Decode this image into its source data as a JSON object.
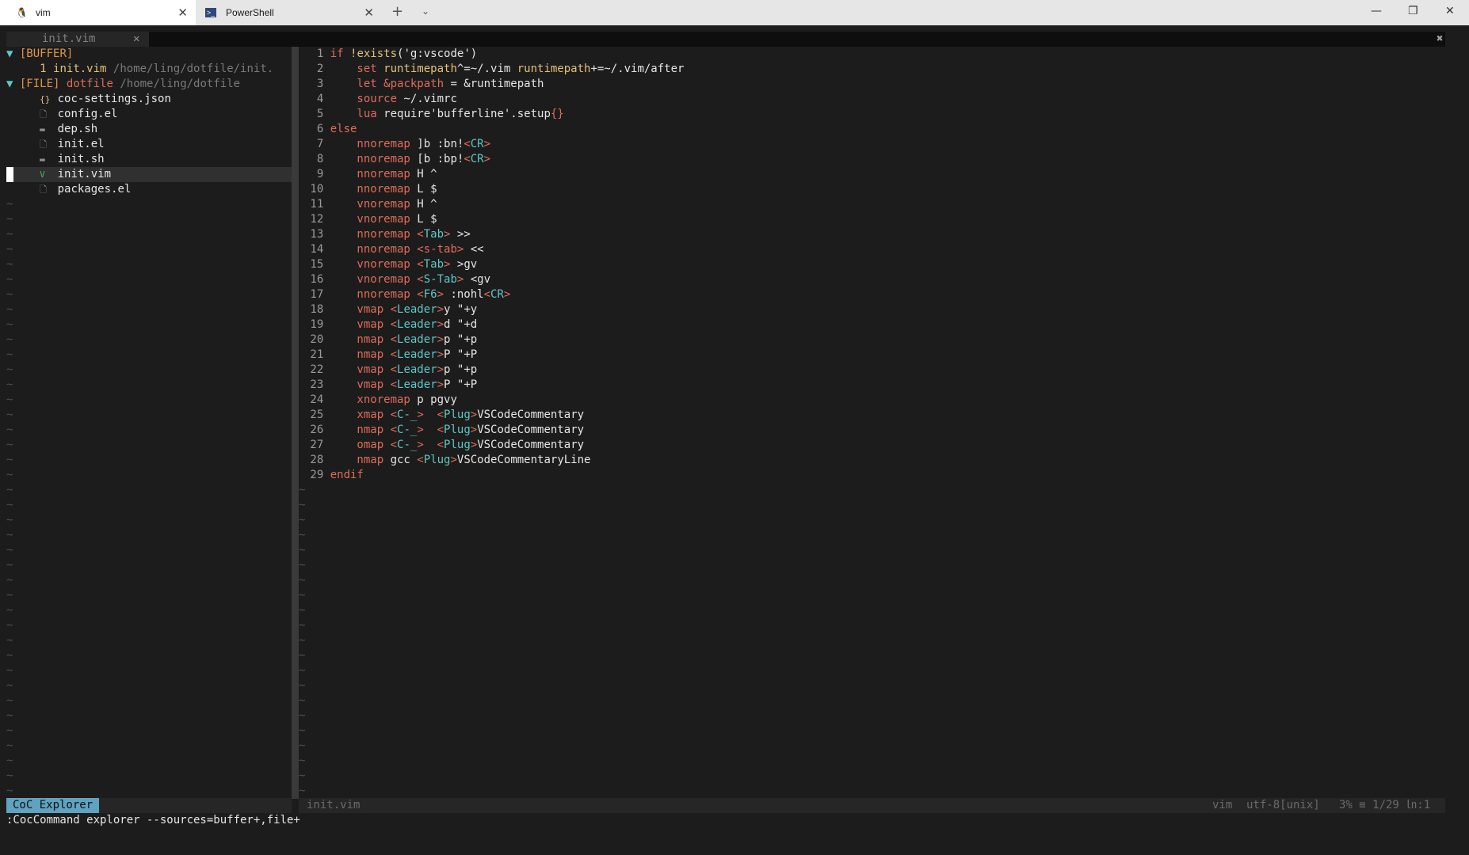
{
  "window": {
    "tabs": [
      {
        "label": "vim",
        "icon": "linux-penguin-icon",
        "active": true
      },
      {
        "label": "PowerShell",
        "icon": "powershell-icon",
        "active": false
      }
    ],
    "new_tab_glyph": "+",
    "dropdown_glyph": "⌄",
    "close_glyph": "✕",
    "controls": {
      "minimize": "—",
      "maximize": "❐",
      "close": "✕"
    }
  },
  "vim_tabline": {
    "current_tab": "init.vim",
    "close_glyph": "✕",
    "right_close": "✖"
  },
  "explorer": {
    "buffer_header": {
      "arrow": "▼",
      "label": "[BUFFER]"
    },
    "buffer_item": {
      "num": "1",
      "name": "init.vim",
      "path": "/home/ling/dotfile/init."
    },
    "file_header": {
      "arrow": "▼",
      "label": "[FILE]",
      "name": "dotfile",
      "path": "/home/ling/dotfile"
    },
    "files": [
      {
        "icon": "{}",
        "name": "coc-settings.json",
        "icon_name": "json-icon"
      },
      {
        "icon": "🗋",
        "name": "config.el",
        "icon_name": "file-icon"
      },
      {
        "icon": "▬",
        "name": "dep.sh",
        "icon_name": "shell-icon"
      },
      {
        "icon": "🗋",
        "name": "init.el",
        "icon_name": "file-icon"
      },
      {
        "icon": "▬",
        "name": "init.sh",
        "icon_name": "shell-icon"
      },
      {
        "icon": "V",
        "name": "init.vim",
        "icon_name": "vim-icon"
      },
      {
        "icon": "🗋",
        "name": "packages.el",
        "icon_name": "file-icon"
      }
    ]
  },
  "editor": {
    "line_numbers": [
      "1",
      "2",
      "3",
      "4",
      "5",
      "6",
      "7",
      "8",
      "9",
      "10",
      "11",
      "12",
      "13",
      "14",
      "15",
      "16",
      "17",
      "18",
      "19",
      "20",
      "21",
      "22",
      "23",
      "24",
      "25",
      "26",
      "27",
      "28",
      "29"
    ],
    "lines": [
      [
        [
          "if ",
          "red"
        ],
        [
          "!exists",
          "yellow"
        ],
        [
          "(",
          "white"
        ],
        [
          "'g:vscode'",
          "white"
        ],
        [
          ")",
          "white"
        ]
      ],
      [
        [
          "    set ",
          "red"
        ],
        [
          "runtimepath",
          "yellow"
        ],
        [
          "^=~/.vim ",
          "white"
        ],
        [
          "runtimepath",
          "yellow"
        ],
        [
          "+=~/.vim/after",
          "white"
        ]
      ],
      [
        [
          "    let ",
          "red"
        ],
        [
          "&packpath",
          "red"
        ],
        [
          " = &runtimepath",
          "white"
        ]
      ],
      [
        [
          "    source ",
          "red"
        ],
        [
          "~/.vimrc",
          "white"
        ]
      ],
      [
        [
          "    lua ",
          "red"
        ],
        [
          "require'bufferline'.setup",
          "white"
        ],
        [
          "{}",
          "red"
        ]
      ],
      [
        [
          "else",
          "red"
        ]
      ],
      [
        [
          "    nnoremap ",
          "red"
        ],
        [
          "]b :bn!",
          "white"
        ],
        [
          "<",
          "red"
        ],
        [
          "CR",
          "teal"
        ],
        [
          ">",
          "red"
        ]
      ],
      [
        [
          "    nnoremap ",
          "red"
        ],
        [
          "[b :bp!",
          "white"
        ],
        [
          "<",
          "red"
        ],
        [
          "CR",
          "teal"
        ],
        [
          ">",
          "red"
        ]
      ],
      [
        [
          "    nnoremap ",
          "red"
        ],
        [
          "H ^",
          "white"
        ]
      ],
      [
        [
          "    nnoremap ",
          "red"
        ],
        [
          "L $",
          "white"
        ]
      ],
      [
        [
          "    vnoremap ",
          "red"
        ],
        [
          "H ^",
          "white"
        ]
      ],
      [
        [
          "    vnoremap ",
          "red"
        ],
        [
          "L $",
          "white"
        ]
      ],
      [
        [
          "    nnoremap ",
          "red"
        ],
        [
          "<",
          "red"
        ],
        [
          "Tab",
          "teal"
        ],
        [
          "> ",
          "red"
        ],
        [
          ">>",
          "white"
        ]
      ],
      [
        [
          "    nnoremap ",
          "red"
        ],
        [
          "<s-tab>",
          "red"
        ],
        [
          " <<",
          "white"
        ]
      ],
      [
        [
          "    vnoremap ",
          "red"
        ],
        [
          "<",
          "red"
        ],
        [
          "Tab",
          "teal"
        ],
        [
          "> ",
          "red"
        ],
        [
          ">gv",
          "white"
        ]
      ],
      [
        [
          "    vnoremap ",
          "red"
        ],
        [
          "<",
          "red"
        ],
        [
          "S-Tab",
          "teal"
        ],
        [
          "> ",
          "red"
        ],
        [
          "<gv",
          "white"
        ]
      ],
      [
        [
          "    nnoremap ",
          "red"
        ],
        [
          "<",
          "red"
        ],
        [
          "F6",
          "teal"
        ],
        [
          "> ",
          "red"
        ],
        [
          ":nohl",
          "white"
        ],
        [
          "<",
          "red"
        ],
        [
          "CR",
          "teal"
        ],
        [
          ">",
          "red"
        ]
      ],
      [
        [
          "    vmap ",
          "red"
        ],
        [
          "<",
          "red"
        ],
        [
          "Leader",
          "teal"
        ],
        [
          ">",
          "red"
        ],
        [
          "y \"+y",
          "white"
        ]
      ],
      [
        [
          "    vmap ",
          "red"
        ],
        [
          "<",
          "red"
        ],
        [
          "Leader",
          "teal"
        ],
        [
          ">",
          "red"
        ],
        [
          "d \"+d",
          "white"
        ]
      ],
      [
        [
          "    nmap ",
          "red"
        ],
        [
          "<",
          "red"
        ],
        [
          "Leader",
          "teal"
        ],
        [
          ">",
          "red"
        ],
        [
          "p \"+p",
          "white"
        ]
      ],
      [
        [
          "    nmap ",
          "red"
        ],
        [
          "<",
          "red"
        ],
        [
          "Leader",
          "teal"
        ],
        [
          ">",
          "red"
        ],
        [
          "P \"+P",
          "white"
        ]
      ],
      [
        [
          "    vmap ",
          "red"
        ],
        [
          "<",
          "red"
        ],
        [
          "Leader",
          "teal"
        ],
        [
          ">",
          "red"
        ],
        [
          "p \"+p",
          "white"
        ]
      ],
      [
        [
          "    vmap ",
          "red"
        ],
        [
          "<",
          "red"
        ],
        [
          "Leader",
          "teal"
        ],
        [
          ">",
          "red"
        ],
        [
          "P \"+P",
          "white"
        ]
      ],
      [
        [
          "    xnoremap ",
          "red"
        ],
        [
          "p pgvy",
          "white"
        ]
      ],
      [
        [
          "    xmap ",
          "red"
        ],
        [
          "<",
          "red"
        ],
        [
          "C-_",
          "teal"
        ],
        [
          ">  ",
          "red"
        ],
        [
          "<",
          "red"
        ],
        [
          "Plug",
          "teal"
        ],
        [
          ">",
          "red"
        ],
        [
          "VSCodeCommentary",
          "white"
        ]
      ],
      [
        [
          "    nmap ",
          "red"
        ],
        [
          "<",
          "red"
        ],
        [
          "C-_",
          "teal"
        ],
        [
          ">  ",
          "red"
        ],
        [
          "<",
          "red"
        ],
        [
          "Plug",
          "teal"
        ],
        [
          ">",
          "red"
        ],
        [
          "VSCodeCommentary",
          "white"
        ]
      ],
      [
        [
          "    omap ",
          "red"
        ],
        [
          "<",
          "red"
        ],
        [
          "C-_",
          "teal"
        ],
        [
          ">  ",
          "red"
        ],
        [
          "<",
          "red"
        ],
        [
          "Plug",
          "teal"
        ],
        [
          ">",
          "red"
        ],
        [
          "VSCodeCommentary",
          "white"
        ]
      ],
      [
        [
          "    nmap ",
          "red"
        ],
        [
          "gcc ",
          "white"
        ],
        [
          "<",
          "red"
        ],
        [
          "Plug",
          "teal"
        ],
        [
          ">",
          "red"
        ],
        [
          "VSCodeCommentaryLine",
          "white"
        ]
      ],
      [
        [
          "endif",
          "red"
        ]
      ]
    ],
    "tilde": "~"
  },
  "statusline": {
    "left_badge": "CoC Explorer",
    "right_file": "init.vim",
    "filetype": "vim",
    "encoding": "utf-8[unix]",
    "position": "3% ≡ 1/29  ㏑:1"
  },
  "cmdline": ":CocCommand explorer --sources=buffer+,file+"
}
